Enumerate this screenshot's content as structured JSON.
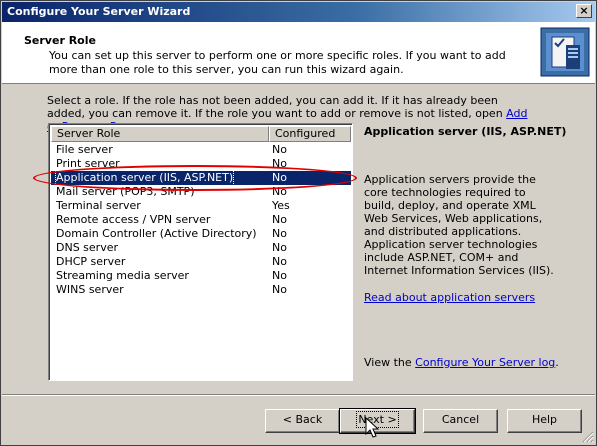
{
  "window": {
    "title": "Configure Your Server Wizard",
    "close_glyph": "×"
  },
  "header": {
    "title": "Server Role",
    "description": "You can set up this server to perform one or more specific roles. If you want to add more than one role to this server, you can run this wizard again.",
    "icon": "server-wizard-icon"
  },
  "intro": {
    "text": "Select a role. If the role has not been added, you can add it. If it has already been added, you can remove it. If the role you want to add or remove is not listed, open ",
    "link": "Add or Remove Programs",
    "suffix": "."
  },
  "roles": {
    "columns": [
      "Server Role",
      "Configured"
    ],
    "rows": [
      {
        "role": "File server",
        "configured": "No"
      },
      {
        "role": "Print server",
        "configured": "No"
      },
      {
        "role": "Application server (IIS, ASP.NET)",
        "configured": "No",
        "selected": true
      },
      {
        "role": "Mail server (POP3, SMTP)",
        "configured": "No"
      },
      {
        "role": "Terminal server",
        "configured": "Yes"
      },
      {
        "role": "Remote access / VPN server",
        "configured": "No"
      },
      {
        "role": "Domain Controller (Active Directory)",
        "configured": "No"
      },
      {
        "role": "DNS server",
        "configured": "No"
      },
      {
        "role": "DHCP server",
        "configured": "No"
      },
      {
        "role": "Streaming media server",
        "configured": "No"
      },
      {
        "role": "WINS server",
        "configured": "No"
      }
    ]
  },
  "detail": {
    "title": "Application server (IIS, ASP.NET)",
    "description": "Application servers provide the core technologies required to build, deploy, and operate XML Web Services, Web applications, and distributed applications. Application server technologies include ASP.NET, COM+ and Internet Information Services (IIS).",
    "read_link": "Read about application servers",
    "log_prefix": "View the ",
    "log_link": "Configure Your Server log",
    "log_suffix": "."
  },
  "buttons": {
    "back": "< Back",
    "next": "Next >",
    "cancel": "Cancel",
    "help": "Help"
  },
  "colors": {
    "selection": "#0a246a",
    "highlight_ring": "#e00000",
    "link": "#0000cc"
  }
}
